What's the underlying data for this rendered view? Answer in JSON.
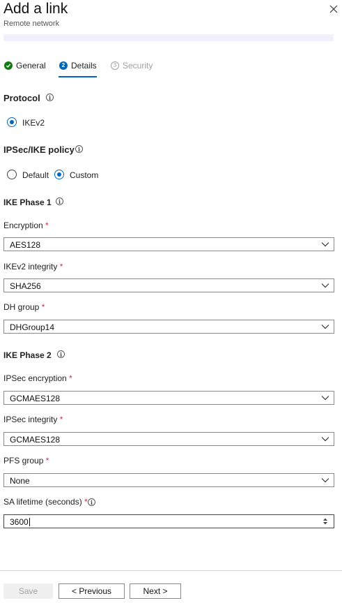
{
  "header": {
    "title": "Add a link",
    "subtitle": "Remote network",
    "close_icon": "close-icon"
  },
  "tabs": [
    {
      "label": "General",
      "state": "completed",
      "badge": ""
    },
    {
      "label": "Details",
      "state": "active",
      "badge": "2"
    },
    {
      "label": "Security",
      "state": "disabled",
      "badge": "3"
    }
  ],
  "protocol": {
    "heading": "Protocol",
    "options": [
      {
        "label": "IKEv2",
        "selected": true
      }
    ]
  },
  "policy": {
    "heading": "IPSec/IKE policy",
    "options": [
      {
        "label": "Default",
        "selected": false
      },
      {
        "label": "Custom",
        "selected": true
      }
    ]
  },
  "phase1": {
    "heading": "IKE Phase 1",
    "encryption": {
      "label": "Encryption",
      "required": "*",
      "value": "AES128"
    },
    "integrity": {
      "label": "IKEv2 integrity",
      "required": "*",
      "value": "SHA256"
    },
    "dh_group": {
      "label": "DH group",
      "required": "*",
      "value": "DHGroup14"
    }
  },
  "phase2": {
    "heading": "IKE Phase 2",
    "ipsec_encryption": {
      "label": "IPSec encryption",
      "required": "*",
      "value": "GCMAES128"
    },
    "ipsec_integrity": {
      "label": "IPSec integrity",
      "required": "*",
      "value": "GCMAES128"
    },
    "pfs_group": {
      "label": "PFS group",
      "required": "*",
      "value": "None"
    },
    "sa_lifetime": {
      "label": "SA lifetime (seconds)",
      "required": "*",
      "value": "3600"
    }
  },
  "footer": {
    "save_label": "Save",
    "previous_label": "< Previous",
    "next_label": "Next >"
  },
  "colors": {
    "accent": "#0067b8",
    "success": "#107c10",
    "required": "#c4314b"
  }
}
